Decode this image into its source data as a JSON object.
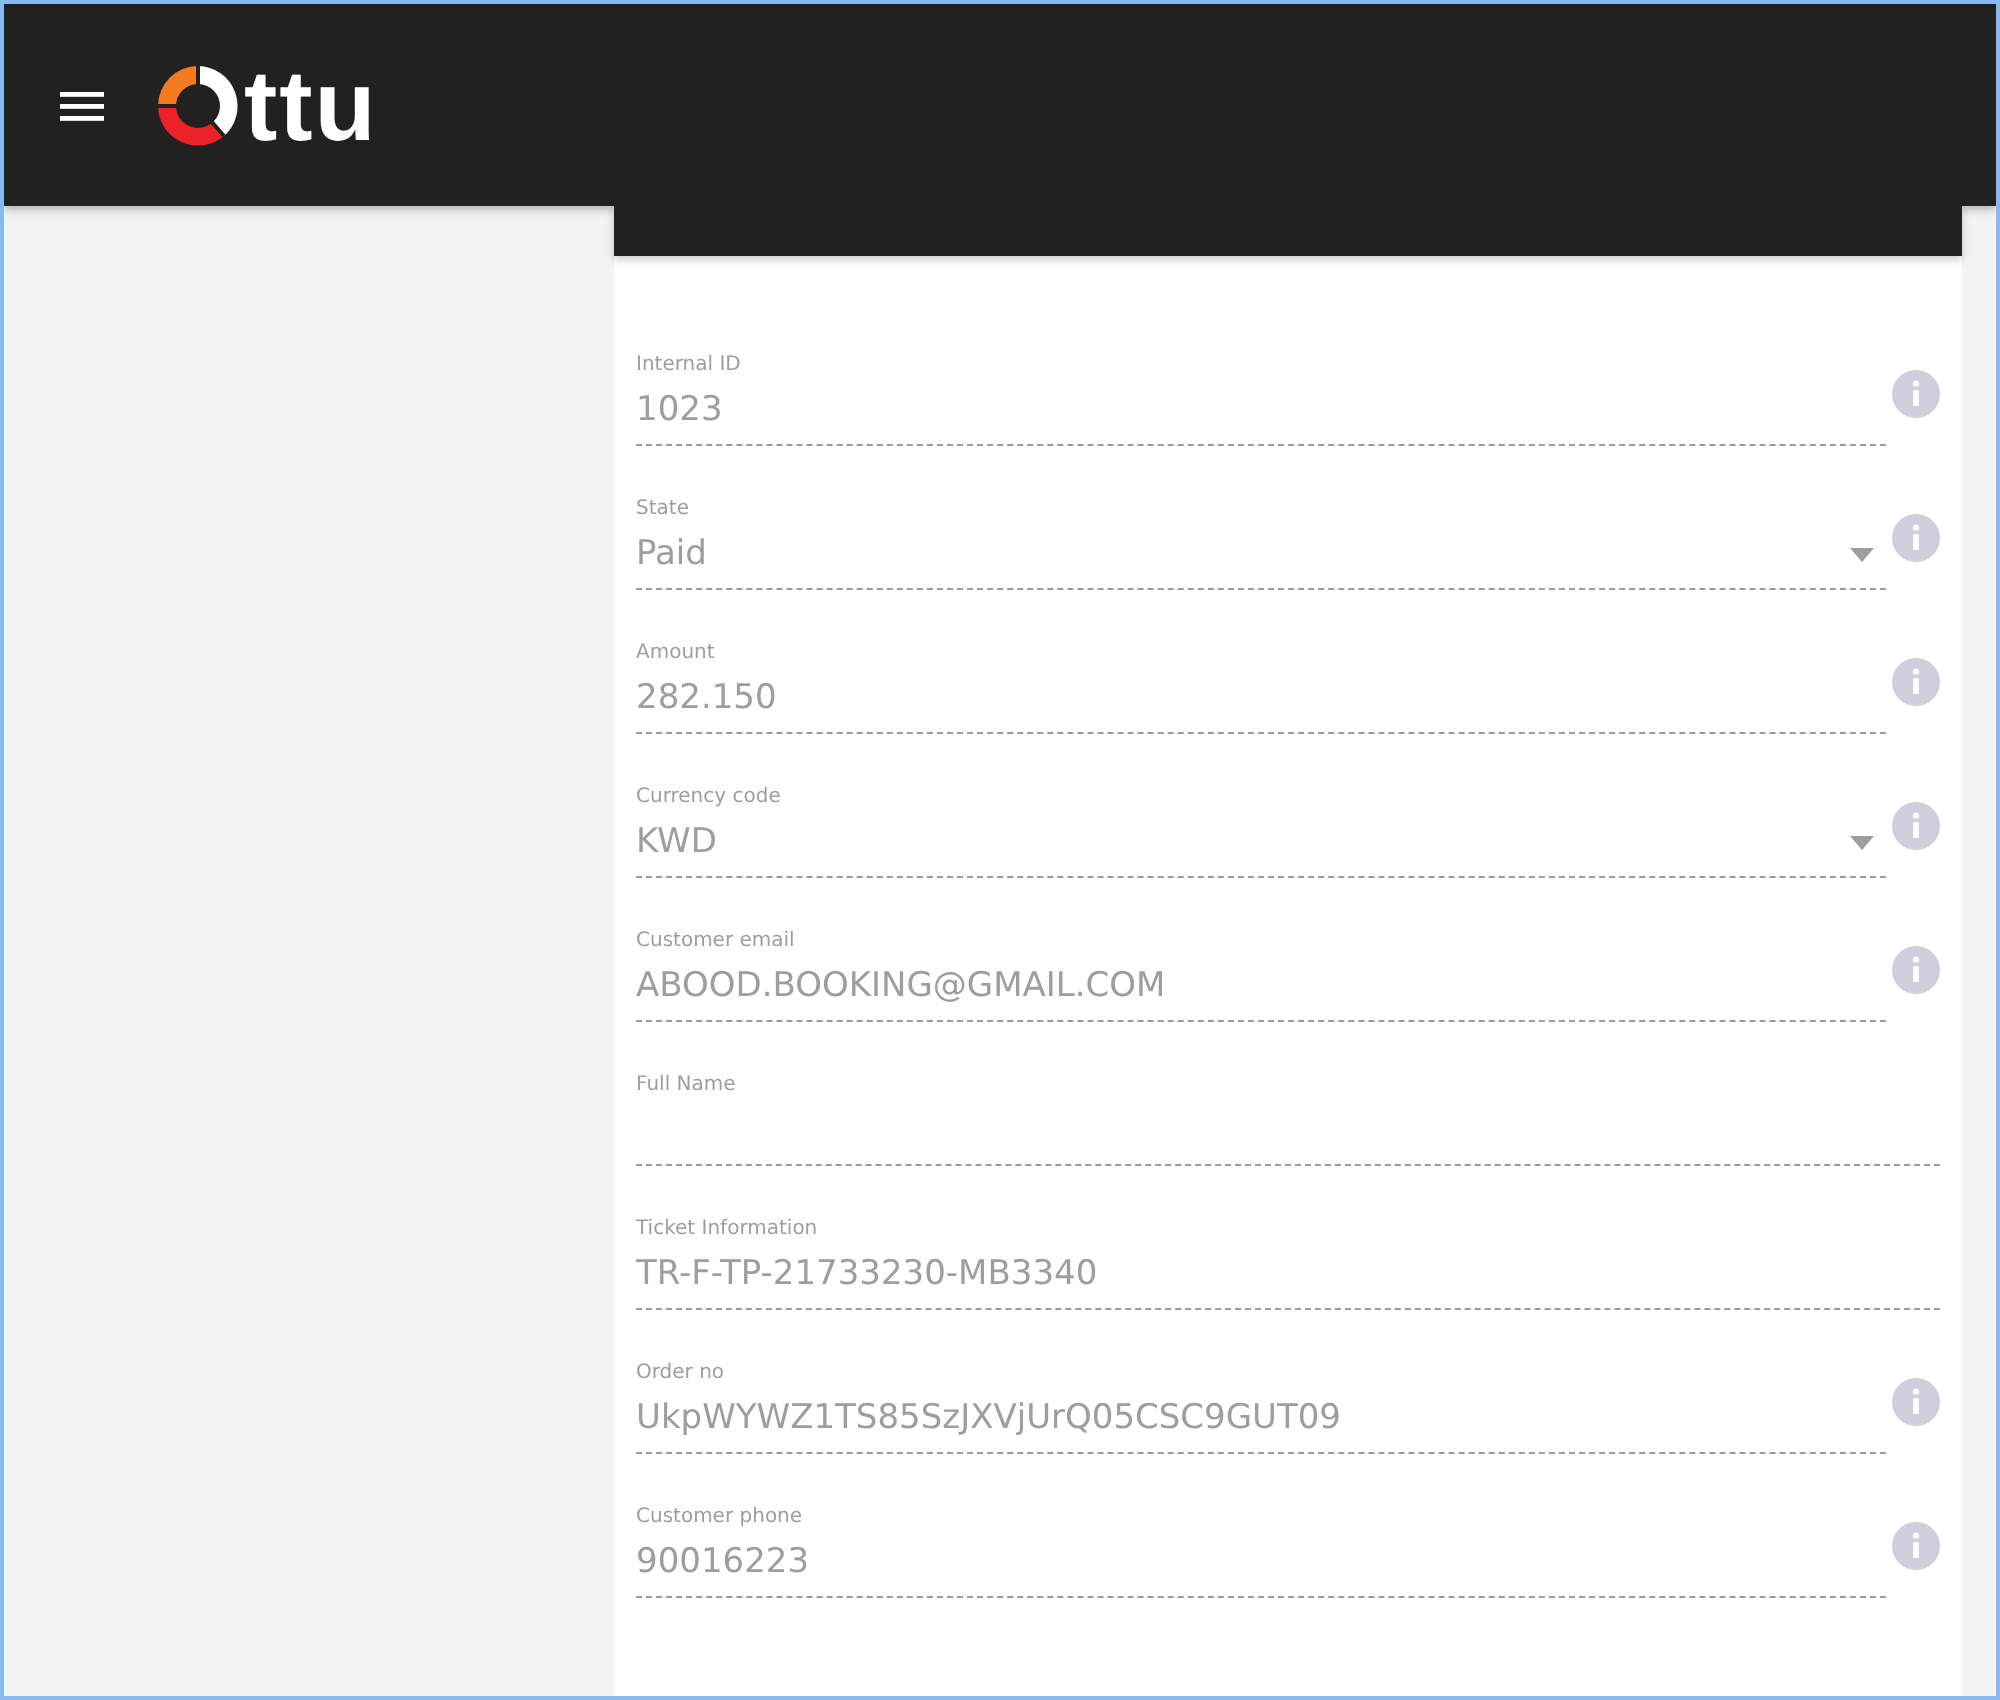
{
  "header": {
    "logo_text": "ttu"
  },
  "fields": [
    {
      "label": "Internal ID",
      "value": "1023",
      "kind": "text",
      "info": true
    },
    {
      "label": "State",
      "value": "Paid",
      "kind": "select",
      "info": true
    },
    {
      "label": "Amount",
      "value": "282.150",
      "kind": "text",
      "info": true
    },
    {
      "label": "Currency code",
      "value": "KWD",
      "kind": "select",
      "info": true
    },
    {
      "label": "Customer email",
      "value": "ABOOD.BOOKING@GMAIL.COM",
      "kind": "text",
      "info": true
    },
    {
      "label": "Full Name",
      "kind": "text",
      "info": false
    },
    {
      "label": "Ticket Information",
      "value": "TR-F-TP-21733230-MB3340",
      "kind": "text",
      "info": false
    },
    {
      "label": "Order no",
      "value": "UkpWYWZ1TS85SzJXVjUrQ05CSC9GUT09",
      "kind": "text",
      "info": true
    },
    {
      "label": "Customer phone",
      "value": "90016223",
      "kind": "text",
      "info": true
    }
  ]
}
